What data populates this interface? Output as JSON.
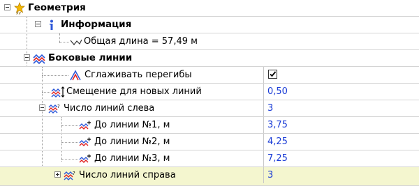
{
  "geometry": {
    "label": "Геометрия",
    "info": {
      "label": "Информация",
      "total_length": "Общая длина = 57,49 м"
    },
    "side_lines": {
      "label": "Боковые линии",
      "smooth_bends": {
        "label": "Сглаживать перегибы",
        "checked": true
      },
      "offset_new_lines": {
        "label": "Смещение для новых линий",
        "value": "0,50"
      },
      "lines_left": {
        "label": "Число линий слева",
        "value": "3",
        "items": [
          {
            "label": "До линии №1, м",
            "value": "3,75"
          },
          {
            "label": "До линии №2, м",
            "value": "4,25"
          },
          {
            "label": "До линии №3, м",
            "value": "7,25"
          }
        ]
      },
      "lines_right": {
        "label": "Число линий справа",
        "value": "3"
      }
    }
  },
  "colors": {
    "value_text": "#1a3cd6",
    "grid": "#d4d4d4",
    "selection": "#f4f6cf"
  },
  "icons": {
    "geometry": "geometry-xy-icon",
    "info": "info-icon",
    "side_lines": "side-lines-icon",
    "total_length": "polyline-length-icon",
    "smooth_bends": "smooth-bends-icon",
    "offset": "offset-lines-icon",
    "lines_left": "lines-left-icon",
    "line_item": "line-distance-icon",
    "lines_right": "lines-right-icon"
  }
}
